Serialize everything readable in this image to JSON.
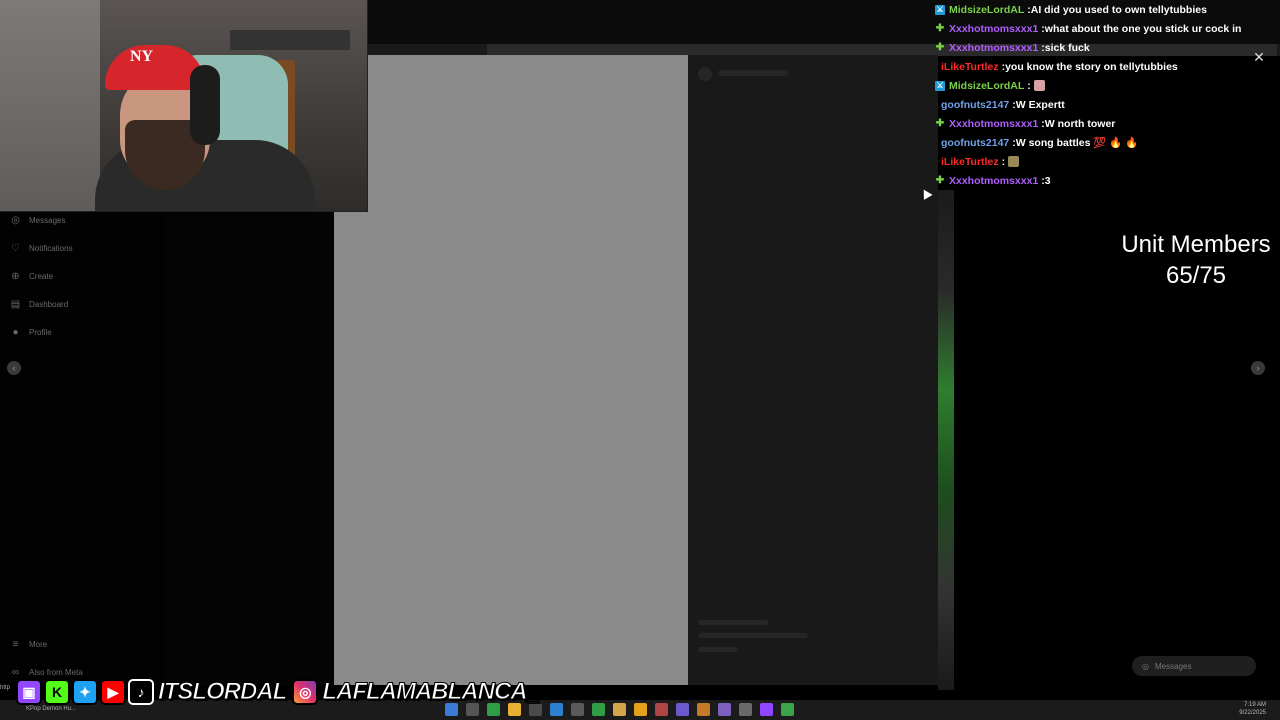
{
  "chat": {
    "messages": [
      {
        "badge": "mod",
        "user": "MidsizeLordAL",
        "color": "#7bd14b",
        "text": "AI did you used to own tellytubbies",
        "emote": null
      },
      {
        "badge": "sub",
        "user": "Xxxhotmomsxxx1",
        "color": "#b05cff",
        "text": "what about the one you stick ur cock in",
        "emote": null
      },
      {
        "badge": "sub",
        "user": "Xxxhotmomsxxx1",
        "color": "#b05cff",
        "text": "sick fuck",
        "emote": null
      },
      {
        "badge": "",
        "user": "iLikeTurtlez",
        "color": "#ff2a2a",
        "text": "you know the story on tellytubbies",
        "emote": null
      },
      {
        "badge": "mod",
        "user": "MidsizeLordAL",
        "color": "#7bd14b",
        "text": "",
        "emote": "#d9a0a6"
      },
      {
        "badge": "",
        "user": "goofnuts2147",
        "color": "#6fa0e6",
        "text": "W Expertt",
        "emote": null
      },
      {
        "badge": "sub",
        "user": "Xxxhotmomsxxx1",
        "color": "#b05cff",
        "text": "W north tower",
        "emote": null
      },
      {
        "badge": "",
        "user": "goofnuts2147",
        "color": "#6fa0e6",
        "text": "W song battles 💯 🔥 🔥",
        "emote": null
      },
      {
        "badge": "",
        "user": "iLikeTurtlez",
        "color": "#ff2a2a",
        "text": "",
        "emote": "#9b8a55"
      },
      {
        "badge": "sub",
        "user": "Xxxhotmomsxxx1",
        "color": "#b05cff",
        "text": "3",
        "emote": null
      }
    ]
  },
  "unit": {
    "label": "Unit Members",
    "count": "65/75"
  },
  "sidebar": {
    "items": [
      {
        "label": "Messages",
        "icon": "messenger-icon"
      },
      {
        "label": "Notifications",
        "icon": "heart-icon"
      },
      {
        "label": "Create",
        "icon": "plus-icon"
      },
      {
        "label": "Dashboard",
        "icon": "chart-icon"
      },
      {
        "label": "Profile",
        "icon": "avatar-icon"
      }
    ],
    "more": "More",
    "meta": "Also from Meta"
  },
  "messages_pill": "Messages",
  "socials": {
    "handle1": "ITSLORDAL",
    "handle2": "LAFLAMABLANCA_"
  },
  "webcam": {
    "cap_logo": "NY"
  },
  "taskbar": {
    "time": "7:19 AM",
    "date": "9/22/2025",
    "task": "KPop Demon Hu..."
  },
  "status_url": "http"
}
